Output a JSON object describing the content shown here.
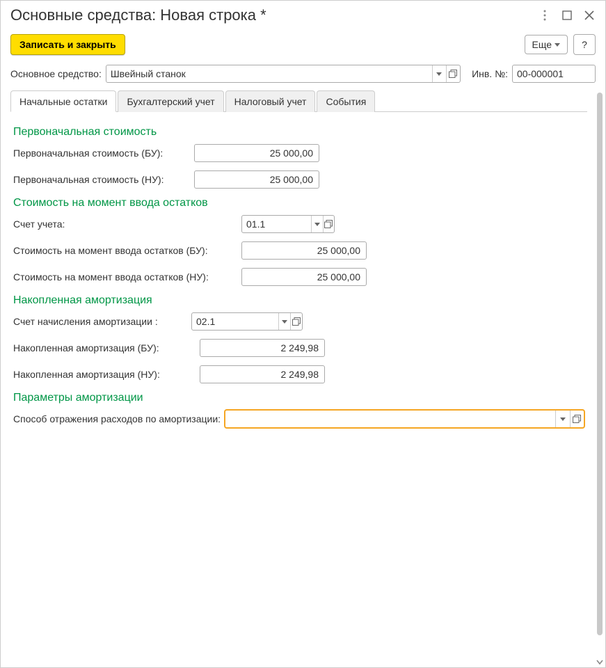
{
  "title": "Основные средства: Новая строка *",
  "toolbar": {
    "save_close": "Записать и закрыть",
    "more": "Еще",
    "help": "?"
  },
  "header": {
    "asset_label": "Основное средство:",
    "asset_value": "Швейный станок",
    "inv_label": "Инв. №:",
    "inv_value": "00-000001"
  },
  "tabs": {
    "t1": "Начальные остатки",
    "t2": "Бухгалтерский учет",
    "t3": "Налоговый учет",
    "t4": "События"
  },
  "sections": {
    "initial_cost": "Первоначальная стоимость",
    "cost_at_entry": "Стоимость на момент ввода остатков",
    "accum_depr": "Накопленная амортизация",
    "depr_params": "Параметры амортизации"
  },
  "fields": {
    "init_cost_bu_label": "Первоначальная стоимость (БУ):",
    "init_cost_bu_value": "25 000,00",
    "init_cost_nu_label": "Первоначальная стоимость (НУ):",
    "init_cost_nu_value": "25 000,00",
    "account_label": "Счет учета:",
    "account_value": "01.1",
    "entry_cost_bu_label": "Стоимость на момент ввода остатков (БУ):",
    "entry_cost_bu_value": "25 000,00",
    "entry_cost_nu_label": "Стоимость на момент ввода остатков (НУ):",
    "entry_cost_nu_value": "25 000,00",
    "depr_account_label": "Счет начисления амортизации :",
    "depr_account_value": "02.1",
    "accum_depr_bu_label": "Накопленная амортизация  (БУ):",
    "accum_depr_bu_value": "2 249,98",
    "accum_depr_nu_label": "Накопленная амортизация  (НУ):",
    "accum_depr_nu_value": "2 249,98",
    "expense_method_label": "Способ отражения расходов по амортизации:",
    "expense_method_value": ""
  }
}
